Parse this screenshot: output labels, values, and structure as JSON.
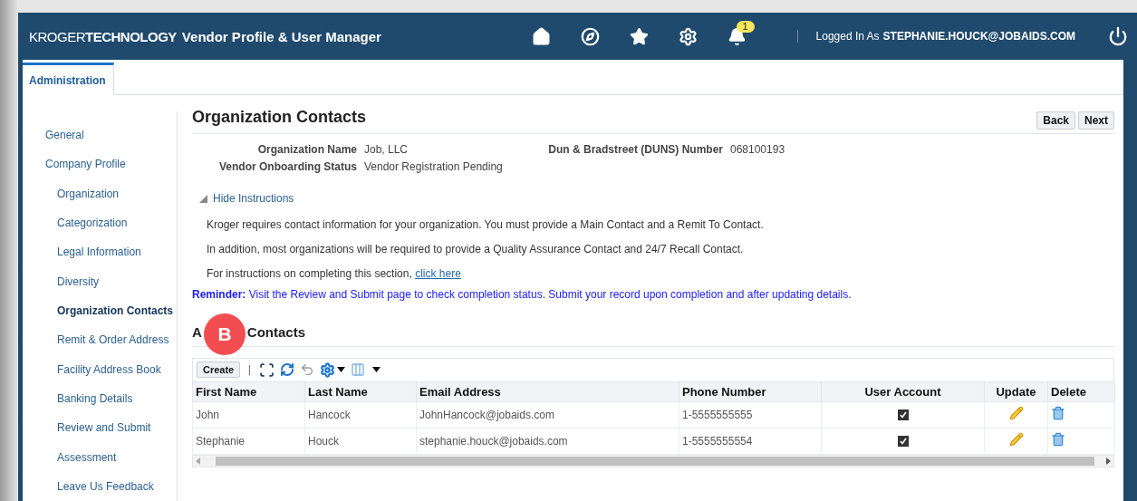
{
  "header": {
    "brand_light": "KROGER",
    "brand_bold": "TECHNOLOGY",
    "app_title": "Vendor Profile & User Manager",
    "notification_count": "1",
    "logged_in_label": "Logged In As",
    "user": "STEPHANIE.HOUCK@JOBAIDS.COM"
  },
  "tabs": [
    {
      "label": "Administration",
      "selected": true
    }
  ],
  "sidebar": {
    "items": [
      {
        "label": "General",
        "selected": false
      },
      {
        "label": "Company Profile",
        "selected": false,
        "children": [
          {
            "label": "Organization",
            "selected": false
          },
          {
            "label": "Categorization",
            "selected": false
          },
          {
            "label": "Legal Information",
            "selected": false
          },
          {
            "label": "Diversity",
            "selected": false
          },
          {
            "label": "Organization Contacts",
            "selected": true
          },
          {
            "label": "Remit & Order Address",
            "selected": false
          },
          {
            "label": "Facility Address Book",
            "selected": false
          },
          {
            "label": "Banking Details",
            "selected": false
          },
          {
            "label": "Review and Submit",
            "selected": false
          },
          {
            "label": "Assessment",
            "selected": false
          },
          {
            "label": "Leave Us Feedback",
            "selected": false
          }
        ]
      }
    ]
  },
  "page": {
    "title": "Organization Contacts",
    "buttons": [
      "Back",
      "Next"
    ],
    "field_rows": [
      [
        {
          "label": "Organization Name",
          "value": "Job, LLC"
        },
        {
          "label": "Dun & Bradstreet (DUNS) Number",
          "value": "068100193"
        }
      ],
      [
        {
          "label": "Vendor Onboarding Status",
          "value": "Vendor Registration Pending"
        }
      ]
    ],
    "instructions_toggle": {
      "label": "Hide Instructions",
      "expanded": true
    },
    "instructions": [
      "Kroger requires contact information for your organization. You must provide a Main Contact and a Remit To Contact.",
      "In addition, most organizations will be required to provide a Quality Assurance Contact and 24/7 Recall Contact."
    ],
    "instruction_link_text": "For instructions on completing this section,",
    "instruction_link": "click here",
    "reminder": "**Reminder:** Visit the Review and Submit page to check completion status. Submit your record upon completion and after updating details."
  },
  "contacts": {
    "title_parts": [
      "A",
      "Contacts"
    ],
    "callout": "B",
    "create_button": "Create",
    "columns": [
      "First Name",
      "Last Name",
      "Email Address",
      "Phone Number",
      "User Account",
      "Update",
      "Delete"
    ],
    "rows": [
      {
        "first_name": "John",
        "last_name": "Hancock",
        "email": "JohnHancock@jobaids.com",
        "phone": "1-5555555555",
        "user_account": true
      },
      {
        "first_name": "Stephanie",
        "last_name": "Houck",
        "email": "stephanie.houck@jobaids.com",
        "phone": "1-5555555554",
        "user_account": true
      }
    ]
  }
}
